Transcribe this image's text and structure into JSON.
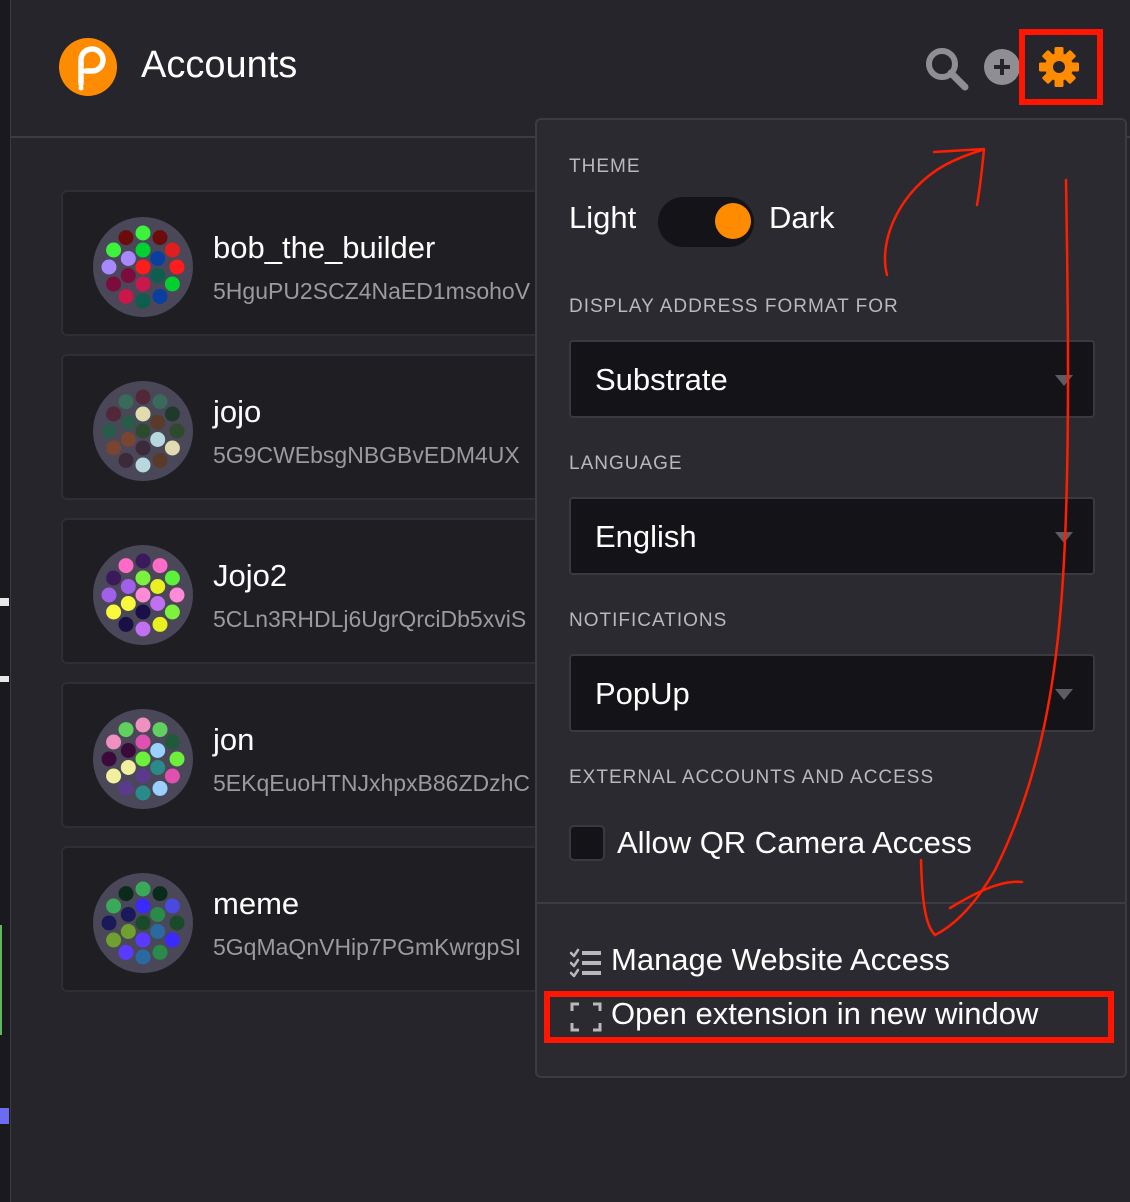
{
  "header": {
    "title": "Accounts",
    "icons": [
      "polkadot-logo",
      "search-icon",
      "add-icon",
      "gear-icon"
    ]
  },
  "accounts": [
    {
      "name": "bob_the_builder",
      "address": "5HguPU2SCZ4NaED1msohoV"
    },
    {
      "name": "jojo",
      "address": "5G9CWEbsgNBGBvEDM4UX"
    },
    {
      "name": "Jojo2",
      "address": "5CLn3RHDLj6UgrQrciDb5xviS"
    },
    {
      "name": "jon",
      "address": "5EKqEuoHTNJxhpxB86ZDzhC"
    },
    {
      "name": "meme",
      "address": "5GqMaQnVHip7PGmKwrgpSI"
    }
  ],
  "settings": {
    "theme_label": "THEME",
    "theme_light": "Light",
    "theme_dark": "Dark",
    "theme_selected": "Dark",
    "address_format_label": "DISPLAY ADDRESS FORMAT FOR",
    "address_format_value": "Substrate",
    "language_label": "LANGUAGE",
    "language_value": "English",
    "notifications_label": "NOTIFICATIONS",
    "notifications_value": "PopUp",
    "external_label": "EXTERNAL ACCOUNTS AND ACCESS",
    "camera_access_label": "Allow QR Camera Access",
    "camera_access_checked": false,
    "manage_website_access": "Manage Website Access",
    "open_new_window": "Open extension in new window"
  },
  "colors": {
    "accent": "#ff8c00",
    "highlight": "#ff1500",
    "background": "#26252b",
    "panel": "#2b2a30"
  }
}
